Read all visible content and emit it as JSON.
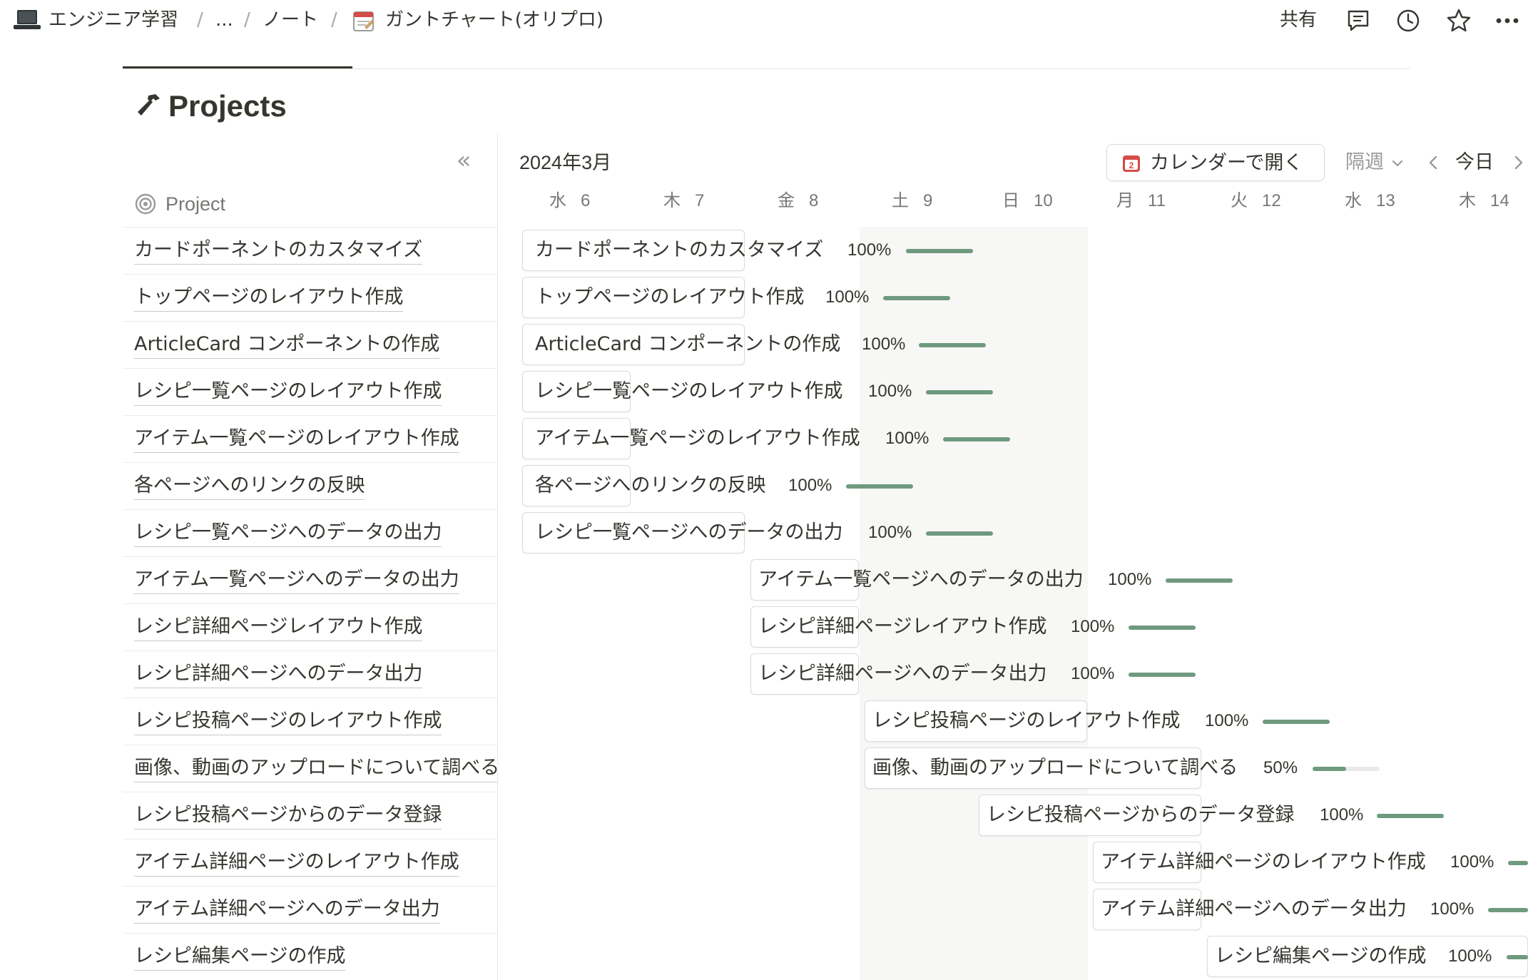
{
  "breadcrumb": {
    "workspace": "エンジニア学習",
    "ellipsis": "...",
    "parent": "ノート",
    "page": "ガントチャート(オリプロ)",
    "separator": "/"
  },
  "topbar": {
    "share_label": "共有",
    "icons": [
      "comment-icon",
      "clock-icon",
      "star-icon",
      "more-icon"
    ]
  },
  "page": {
    "title": "Projects",
    "icon": "hammer-icon"
  },
  "table": {
    "column_header": "Project",
    "collapse_glyph": "«"
  },
  "timeline": {
    "month": "2024年3月",
    "open_calendar_label": "カレンダーで開く",
    "calendar_badge": "2",
    "range_label": "隔週",
    "today_label": "今日",
    "days": [
      {
        "dow": "水",
        "num": "6"
      },
      {
        "dow": "木",
        "num": "7"
      },
      {
        "dow": "金",
        "num": "8"
      },
      {
        "dow": "土",
        "num": "9"
      },
      {
        "dow": "日",
        "num": "10"
      },
      {
        "dow": "月",
        "num": "11"
      },
      {
        "dow": "火",
        "num": "12"
      },
      {
        "dow": "水",
        "num": "13"
      },
      {
        "dow": "木",
        "num": "14"
      }
    ]
  },
  "projects": [
    {
      "name": "カードポーネントのカスタマイズ",
      "progress": "100%",
      "fraction": 1.0
    },
    {
      "name": "トップページのレイアウト作成",
      "progress": "100%",
      "fraction": 1.0
    },
    {
      "name": "ArticleCard コンポーネントの作成",
      "progress": "100%",
      "fraction": 1.0
    },
    {
      "name": "レシピ一覧ページのレイアウト作成",
      "progress": "100%",
      "fraction": 1.0
    },
    {
      "name": "アイテム一覧ページのレイアウト作成",
      "progress": "100%",
      "fraction": 1.0
    },
    {
      "name": "各ページへのリンクの反映",
      "progress": "100%",
      "fraction": 1.0
    },
    {
      "name": "レシピ一覧ページへのデータの出力",
      "progress": "100%",
      "fraction": 1.0
    },
    {
      "name": "アイテム一覧ページへのデータの出力",
      "progress": "100%",
      "fraction": 1.0
    },
    {
      "name": "レシピ詳細ページレイアウト作成",
      "progress": "100%",
      "fraction": 1.0
    },
    {
      "name": "レシピ詳細ページへのデータ出力",
      "progress": "100%",
      "fraction": 1.0
    },
    {
      "name": "レシピ投稿ページのレイアウト作成",
      "progress": "100%",
      "fraction": 1.0
    },
    {
      "name": "画像、動画のアップロードについて調べる",
      "progress": "50%",
      "fraction": 0.5
    },
    {
      "name": "レシピ投稿ページからのデータ登録",
      "progress": "100%",
      "fraction": 1.0
    },
    {
      "name": "アイテム詳細ページのレイアウト作成",
      "progress": "100%",
      "fraction": 1.0
    },
    {
      "name": "アイテム詳細ページへのデータ出力",
      "progress": "100%",
      "fraction": 1.0
    },
    {
      "name": "レシピ編集ページの作成",
      "progress": "100%",
      "fraction": 1.0
    }
  ],
  "colors": {
    "progress_fill": "#6f9a7f",
    "progress_track": "#e9e9e7",
    "text": "#37352f",
    "muted": "#787774",
    "calendar_red": "#d44c47"
  }
}
